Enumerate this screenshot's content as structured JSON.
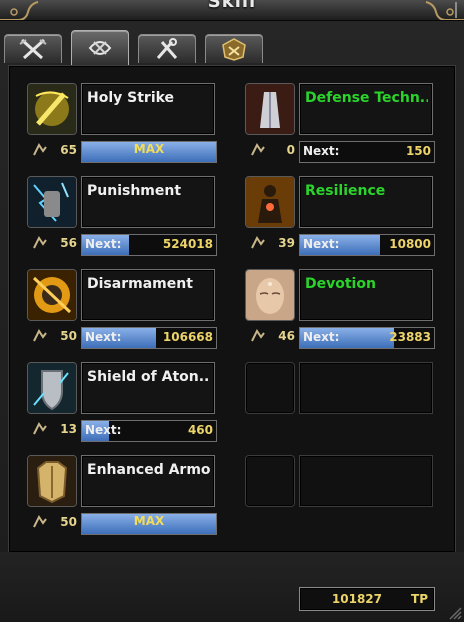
{
  "window": {
    "title": "Skill"
  },
  "tabs": [
    {
      "icon": "crossed-swords-icon",
      "active": false
    },
    {
      "icon": "knot-emblem-icon",
      "active": true
    },
    {
      "icon": "tools-icon",
      "active": false
    },
    {
      "icon": "crest-icon",
      "active": false
    }
  ],
  "skills": [
    {
      "name": "Holy Strike",
      "level": "65",
      "max_label": "MAX",
      "progress": 1.0,
      "icon": "holy-strike-icon"
    },
    {
      "name": "Defense Techn...",
      "level": "0",
      "next_label": "Next:",
      "next_value": "150",
      "progress": 0.0,
      "icon": "defense-technique-icon"
    },
    {
      "name": "Punishment",
      "level": "56",
      "next_label": "Next:",
      "next_value": "524018",
      "progress": 0.35,
      "icon": "punishment-icon"
    },
    {
      "name": "Resilience",
      "level": "39",
      "next_label": "Next:",
      "next_value": "10800",
      "progress": 0.6,
      "icon": "resilience-icon"
    },
    {
      "name": "Disarmament",
      "level": "50",
      "next_label": "Next:",
      "next_value": "106668",
      "progress": 0.55,
      "icon": "disarmament-icon"
    },
    {
      "name": "Devotion",
      "level": "46",
      "next_label": "Next:",
      "next_value": "23883",
      "progress": 0.7,
      "icon": "devotion-icon"
    },
    {
      "name": "Shield of Aton...",
      "level": "13",
      "next_label": "Next:",
      "next_value": "460",
      "progress": 0.2,
      "icon": "shield-of-atonement-icon"
    },
    {
      "name": "Enhanced Armor",
      "level": "50",
      "max_label": "MAX",
      "progress": 1.0,
      "icon": "enhanced-armor-icon"
    }
  ],
  "footer": {
    "tp_value": "101827",
    "tp_label": "TP"
  },
  "colors": {
    "green_name": "#2bd42b",
    "gold_text": "#ecd36a",
    "bar_fill": "#5a86d0"
  }
}
